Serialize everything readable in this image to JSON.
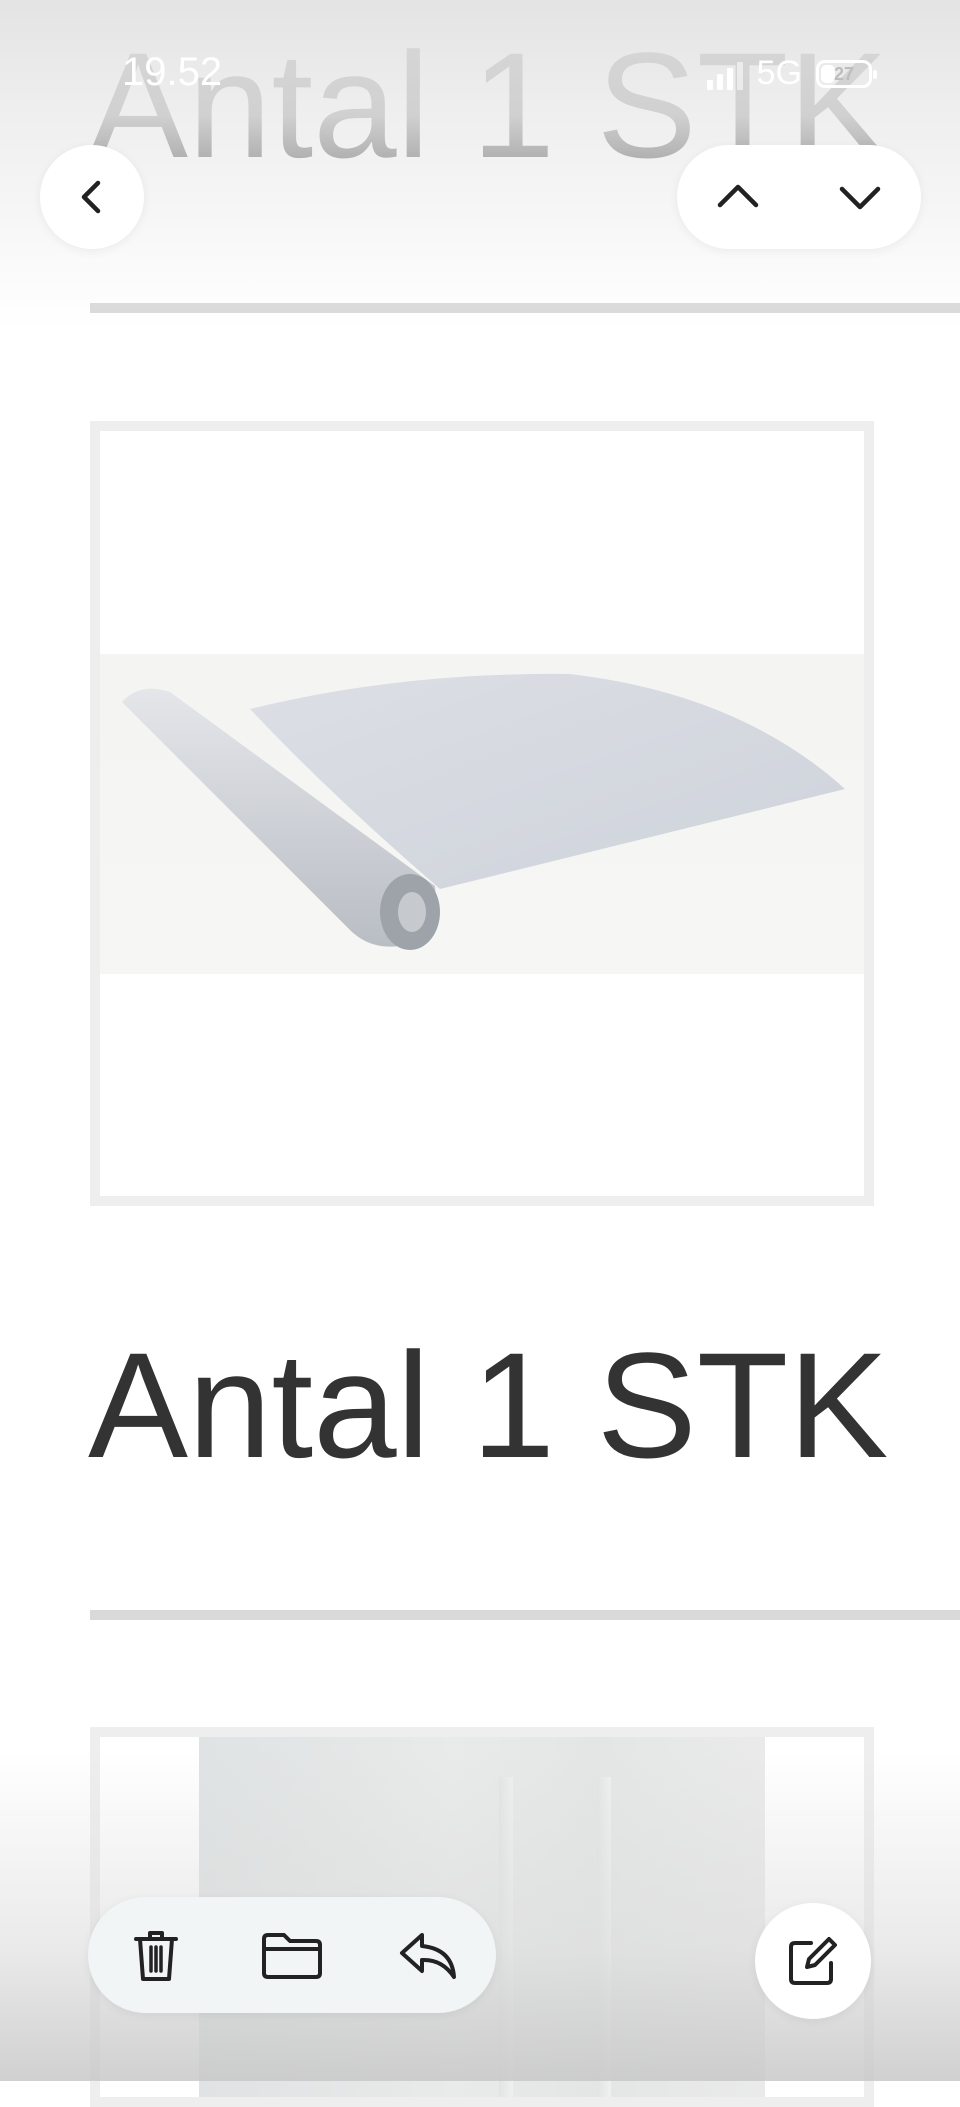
{
  "status_bar": {
    "time": "19.52",
    "network": "5G",
    "battery_level": "27"
  },
  "sections": [
    {
      "quantity_text": "Antal 1 STK"
    },
    {
      "quantity_text": "Antal 1 STK"
    }
  ],
  "products": [
    {
      "image_icon": "floor-mat-roll"
    },
    {
      "image_icon": "room-interior-photo"
    }
  ],
  "toolbar_top": {
    "back_icon": "chevron-left-icon",
    "previous_icon": "chevron-up-icon",
    "next_icon": "chevron-down-icon"
  },
  "toolbar_bottom": {
    "delete_icon": "trash-icon",
    "move_icon": "folder-icon",
    "reply_icon": "reply-icon",
    "compose_icon": "compose-icon"
  },
  "colors": {
    "text": "#333333",
    "divider": "#d9d9d9",
    "card_border": "#eeeeee"
  }
}
